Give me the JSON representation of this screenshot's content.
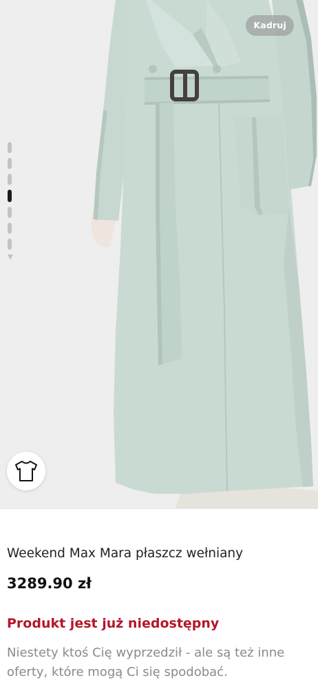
{
  "gallery": {
    "crop_label": "Kadruj",
    "thumbnail_count": 7,
    "active_thumbnail": 4,
    "coat_color": "#c9dad3"
  },
  "product": {
    "title": "Weekend Max Mara płaszcz wełniany",
    "price": "3289.90 zł"
  },
  "availability": {
    "status": "Produkt jest już niedostępny",
    "message": "Niestety ktoś Cię wyprzedził - ale są też inne\noferty, które mogą Ci się spodobać."
  },
  "colors": {
    "status_red": "#b3172a",
    "muted_text": "#8a8a8a"
  },
  "icons": {
    "try_on": "tshirt-icon"
  }
}
